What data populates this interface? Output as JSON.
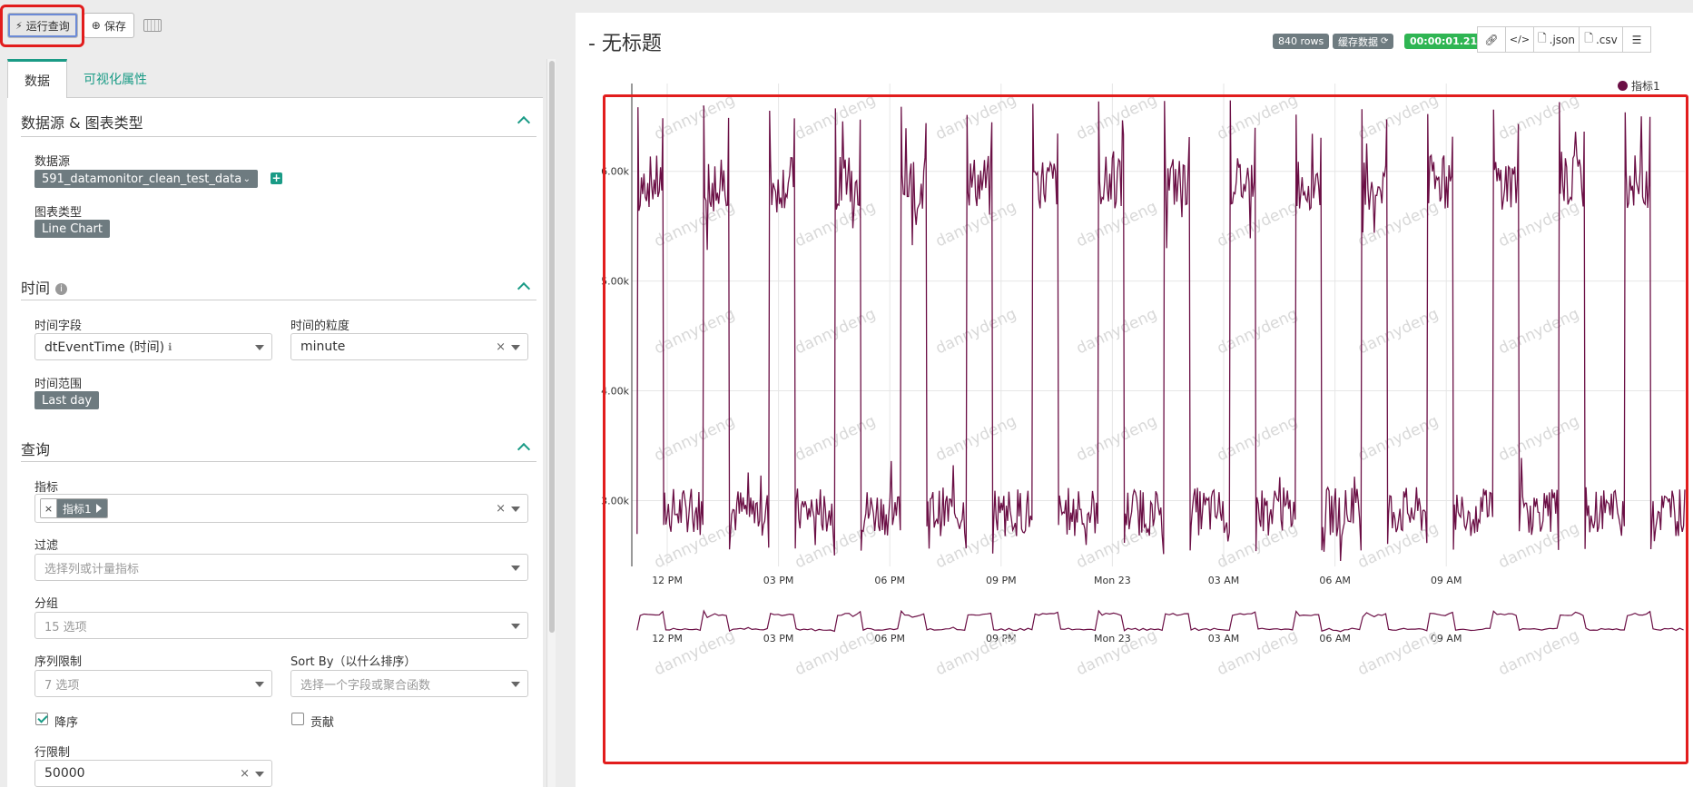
{
  "toolbar": {
    "run_label": "运行查询",
    "save_label": "保存"
  },
  "tabs": [
    {
      "label": "数据"
    },
    {
      "label": "可视化属性"
    }
  ],
  "sections": {
    "datasource": {
      "title": "数据源 & 图表类型",
      "datasource_label": "数据源",
      "datasource_value": "591_datamonitor_clean_test_data",
      "viztype_label": "图表类型",
      "viztype_value": "Line Chart"
    },
    "time": {
      "title": "时间",
      "field_label": "时间字段",
      "field_value": "dtEventTime (时间)",
      "grain_label": "时间的粒度",
      "grain_value": "minute",
      "range_label": "时间范围",
      "range_value": "Last day"
    },
    "query": {
      "title": "查询",
      "metric_label": "指标",
      "metric_value": "指标1",
      "filter_label": "过滤",
      "filter_placeholder": "选择列或计量指标",
      "groupby_label": "分组",
      "groupby_placeholder": "15 选项",
      "series_limit_label": "序列限制",
      "series_limit_placeholder": "7 选项",
      "sortby_label": "Sort By（以什么排序）",
      "sortby_placeholder": "选择一个字段或聚合函数",
      "desc_label": "降序",
      "desc_checked": true,
      "contrib_label": "贡献",
      "contrib_checked": false,
      "row_limit_label": "行限制",
      "row_limit_value": "50000"
    }
  },
  "header": {
    "title": "- 无标题",
    "rows_badge": "840 rows",
    "cache_badge": "缓存数据",
    "timer_badge": "00:00:01.21",
    "json_label": ".json",
    "csv_label": ".csv"
  },
  "colors": {
    "accent": "#1a9b86",
    "series": "#6b0f45",
    "highlight": "#e21d1d",
    "timer": "#2fb553"
  },
  "watermark": "dannydeng",
  "chart_data": {
    "type": "line",
    "title": "",
    "legend": {
      "entries": [
        "指标1"
      ],
      "placement": "top-right"
    },
    "x_ticks": [
      "12 PM",
      "03 PM",
      "06 PM",
      "09 PM",
      "Mon 23",
      "03 AM",
      "06 AM",
      "09 AM"
    ],
    "y_ticks": [
      "3.00k",
      "4.00k",
      "5.00k",
      "6.00k"
    ],
    "ylim": [
      2400,
      6800
    ],
    "grid": true,
    "pattern": {
      "cycles": 16,
      "high_level": 5900,
      "low_level": 2900,
      "peak": 6500,
      "trough": 2500
    },
    "series": [
      {
        "name": "指标1"
      }
    ]
  }
}
